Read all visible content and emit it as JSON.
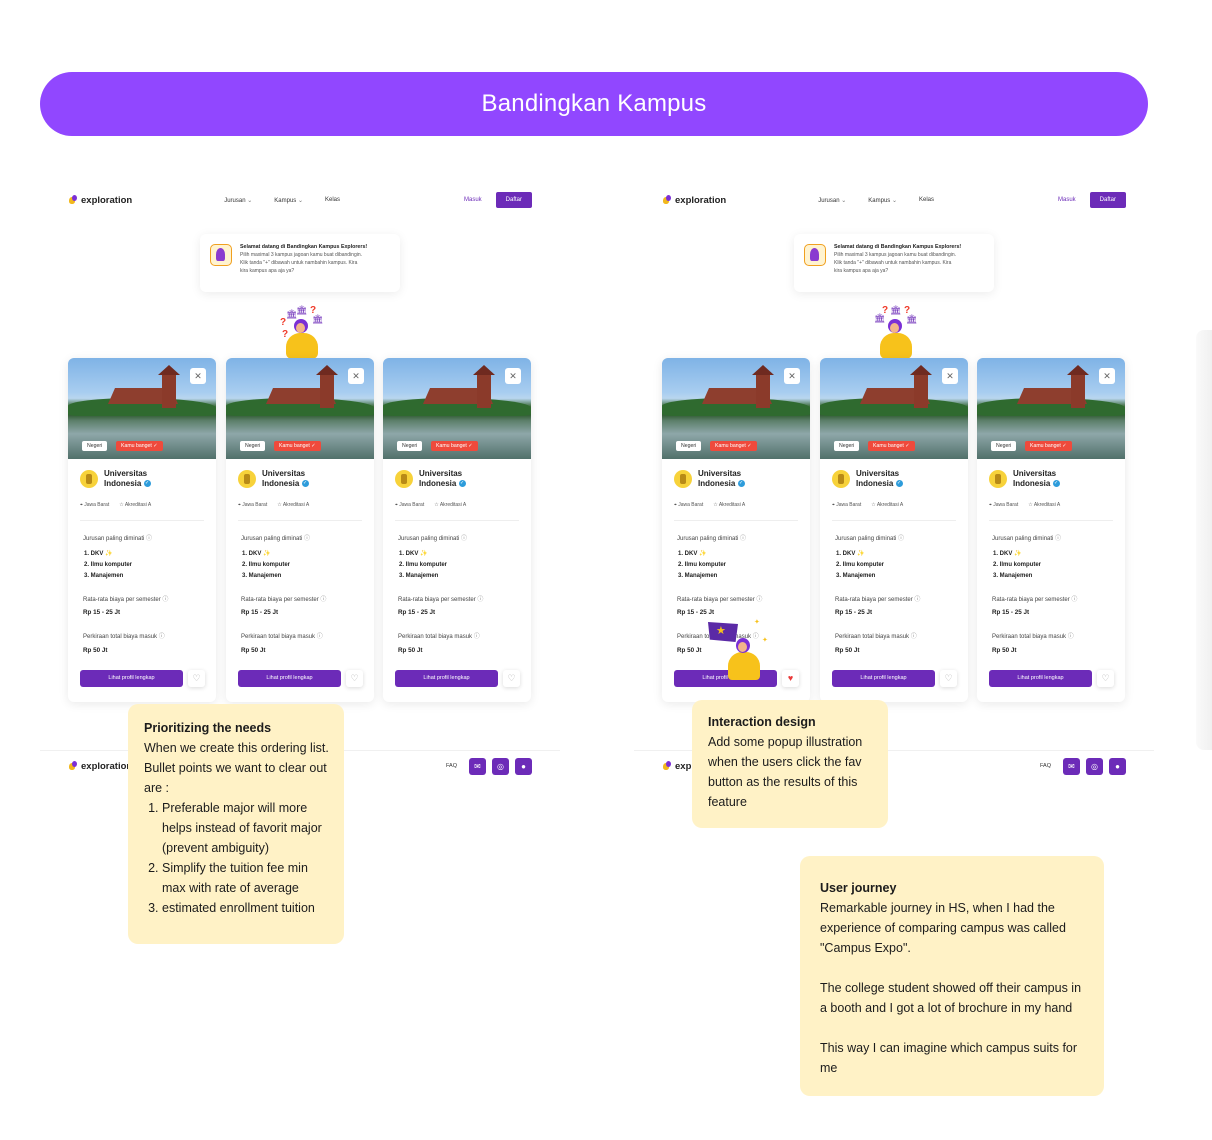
{
  "banner": {
    "title": "Bandingkan Kampus"
  },
  "brand": {
    "name": "exploration"
  },
  "nav": {
    "jurusan": "Jurusan",
    "kampus": "Kampus",
    "kelas": "Kelas",
    "masuk": "Masuk",
    "daftar": "Daftar"
  },
  "welcome": {
    "title": "Selamat datang di Bandingkan Kampus Explorers!",
    "line1": "Pilih maximal 3 kampus jagoan kamu buat dibandingin.",
    "line2": "Klik tanda \"+\" dibawah untuk nambahin kampus. Kira",
    "line3": "kira kampus apa aja ya?"
  },
  "card": {
    "tag_negeri": "Negeri",
    "tag_kamu": "Kamu banget ✓",
    "uni_line1": "Universitas",
    "uni_line2": "Indonesia",
    "location": "Jawa Barat",
    "accreditation": "Akreditasi A",
    "majors_label": "Jurusan paling diminati",
    "majors": [
      "1. DKV",
      "2. Ilmu komputer",
      "3. Manajemen"
    ],
    "fee_label": "Rata-rata biaya per semester",
    "fee_value": "Rp 15 - 25 Jt",
    "total_label": "Perkiraan total biaya masuk",
    "total_value": "Rp 50 Jt",
    "cta": "Lihat profil lengkap"
  },
  "footer": {
    "faq": "FAQ"
  },
  "notes": {
    "prioritizing": {
      "title": "Prioritizing the needs",
      "intro": "When we create this ordering list. Bullet points we want to clear out are :",
      "items": [
        "Preferable major will more helps instead of favorit major (prevent ambiguity)",
        "Simplify the tuition fee min max with rate of average",
        "estimated enrollment tuition"
      ]
    },
    "interaction": {
      "title": "Interaction design",
      "body": "Add some popup illustration when the users click the fav button as the results of this feature"
    },
    "journey": {
      "title": "User journey",
      "p1": "Remarkable journey in HS, when I had the experience of comparing campus was called \"Campus Expo\".",
      "p2": "The college student showed off their campus in a booth and I got a lot of brochure in my hand",
      "p3": "This way I can imagine which campus suits for me"
    }
  },
  "colors": {
    "banner": "#9147ff",
    "primary": "#6c2bb8",
    "note": "#fff2c6",
    "tag_kamu": "#ef4a3c"
  },
  "icons": [
    "close-icon",
    "heart-icon",
    "verified-icon",
    "location-icon",
    "star-icon",
    "info-icon",
    "mail-icon",
    "instagram-icon",
    "chat-icon",
    "chevron-down-icon"
  ]
}
